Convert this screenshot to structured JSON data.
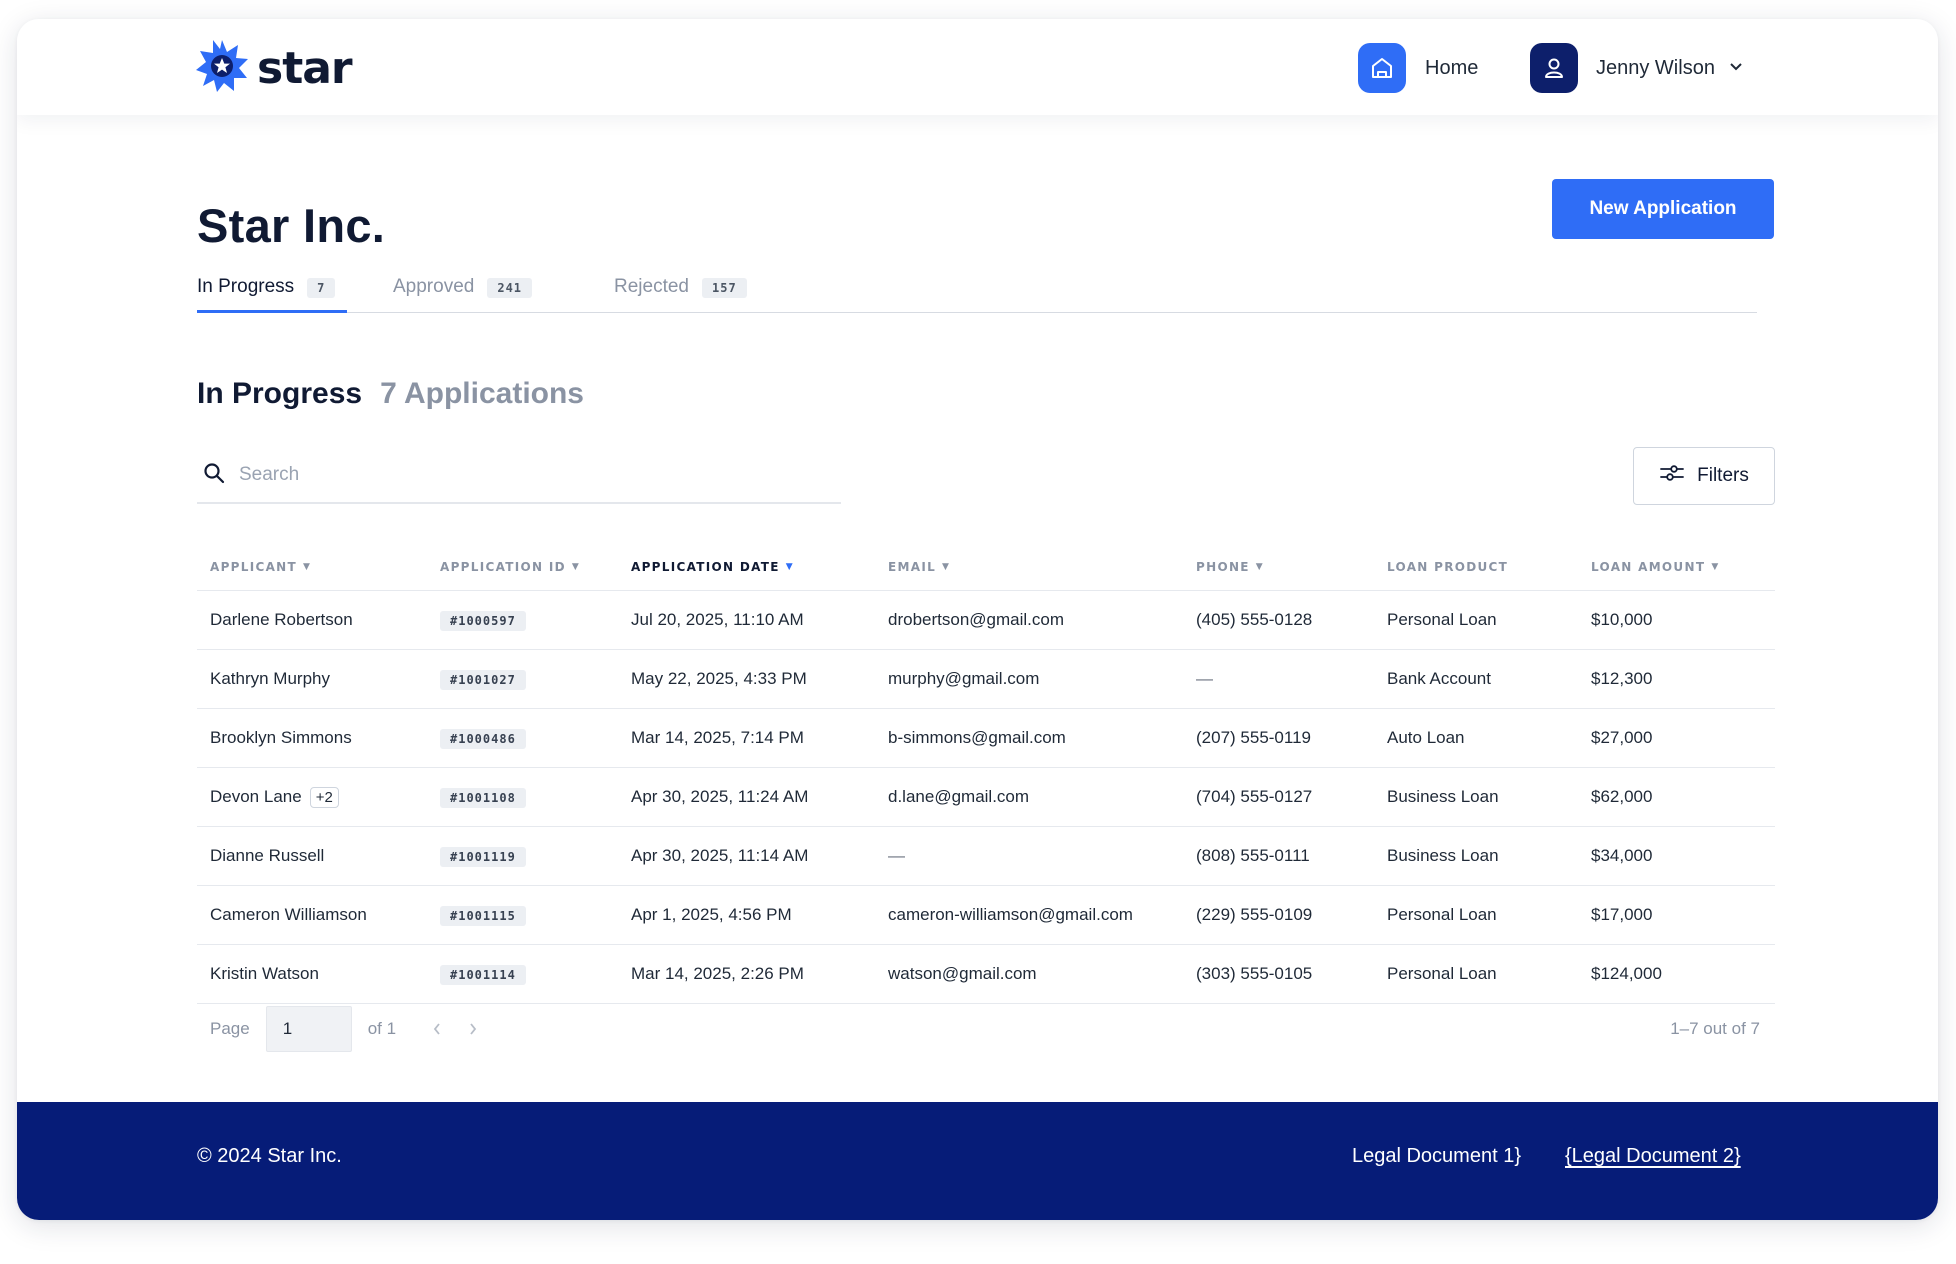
{
  "brand": {
    "name": "star",
    "accent": "#2f6df6",
    "navy": "#061c78"
  },
  "nav": {
    "home_label": "Home",
    "user_name": "Jenny Wilson"
  },
  "page": {
    "title": "Star Inc.",
    "new_button": "New Application"
  },
  "tabs": [
    {
      "label": "In Progress",
      "count": "7",
      "active": true
    },
    {
      "label": "Approved",
      "count": "241",
      "active": false
    },
    {
      "label": "Rejected",
      "count": "157",
      "active": false
    }
  ],
  "section": {
    "title": "In Progress",
    "count_label": "7 Applications"
  },
  "search": {
    "placeholder": "Search",
    "value": ""
  },
  "filters": {
    "label": "Filters"
  },
  "table": {
    "columns": [
      {
        "label": "APPLICANT",
        "sortable": true,
        "sorted": false
      },
      {
        "label": "APPLICATION ID",
        "sortable": true,
        "sorted": false
      },
      {
        "label": "APPLICATION DATE",
        "sortable": true,
        "sorted": true
      },
      {
        "label": "EMAIL",
        "sortable": true,
        "sorted": false
      },
      {
        "label": "PHONE",
        "sortable": true,
        "sorted": false
      },
      {
        "label": "LOAN PRODUCT",
        "sortable": false,
        "sorted": false
      },
      {
        "label": "LOAN AMOUNT",
        "sortable": true,
        "sorted": false
      }
    ],
    "rows": [
      {
        "applicant": "Darlene Robertson",
        "extra": "",
        "id": "#1000597",
        "date": "Jul 20, 2025, 11:10 AM",
        "email": "drobertson@gmail.com",
        "phone": "(405) 555-0128",
        "product": "Personal Loan",
        "amount": "$10,000"
      },
      {
        "applicant": "Kathryn Murphy",
        "extra": "",
        "id": "#1001027",
        "date": "May 22, 2025, 4:33 PM",
        "email": "murphy@gmail.com",
        "phone": "—",
        "product": "Bank Account",
        "amount": "$12,300"
      },
      {
        "applicant": "Brooklyn Simmons",
        "extra": "",
        "id": "#1000486",
        "date": "Mar 14, 2025, 7:14 PM",
        "email": "b-simmons@gmail.com",
        "phone": "(207) 555-0119",
        "product": "Auto Loan",
        "amount": "$27,000"
      },
      {
        "applicant": "Devon Lane",
        "extra": "+2",
        "id": "#1001108",
        "date": "Apr 30, 2025, 11:24 AM",
        "email": "d.lane@gmail.com",
        "phone": "(704) 555-0127",
        "product": "Business Loan",
        "amount": "$62,000"
      },
      {
        "applicant": "Dianne Russell",
        "extra": "",
        "id": "#1001119",
        "date": "Apr 30, 2025, 11:14 AM",
        "email": "—",
        "phone": "(808) 555-0111",
        "product": "Business Loan",
        "amount": "$34,000"
      },
      {
        "applicant": "Cameron Williamson",
        "extra": "",
        "id": "#1001115",
        "date": "Apr 1, 2025, 4:56 PM",
        "email": "cameron-williamson@gmail.com",
        "phone": "(229) 555-0109",
        "product": "Personal Loan",
        "amount": "$17,000"
      },
      {
        "applicant": "Kristin Watson",
        "extra": "",
        "id": "#1001114",
        "date": "Mar 14, 2025, 2:26 PM",
        "email": "watson@gmail.com",
        "phone": "(303) 555-0105",
        "product": "Personal Loan",
        "amount": "$124,000"
      }
    ]
  },
  "pagination": {
    "page_label": "Page",
    "current_page": "1",
    "of_label": "of 1",
    "range_label": "1–7 out of 7"
  },
  "footer": {
    "copyright": "© 2024 Star Inc.",
    "legal1": "Legal Document 1}",
    "legal2": "{Legal Document 2}"
  },
  "icons": {
    "logo": "star-burst-icon",
    "home": "home-icon",
    "user": "user-icon",
    "chevron": "chevron-down-icon",
    "search": "search-icon",
    "filters": "sliders-icon",
    "prev": "chevron-left-icon",
    "next": "chevron-right-icon"
  }
}
